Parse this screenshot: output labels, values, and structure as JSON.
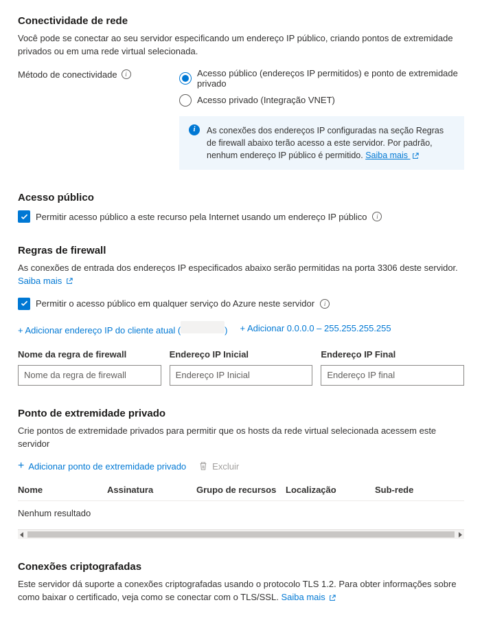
{
  "connectivity": {
    "heading": "Conectividade de rede",
    "desc": "Você pode se conectar ao seu servidor especificando um endereço IP público, criando pontos de extremidade privados ou em uma rede virtual selecionada.",
    "method_label": "Método de conectividade",
    "options": {
      "public": "Acesso público (endereços IP permitidos) e ponto de extremidade privado",
      "private": "Acesso privado (Integração VNET)"
    },
    "info": "As conexões dos endereços IP configuradas na seção Regras de firewall abaixo terão acesso a este servidor. Por padrão, nenhum endereço IP público é permitido.",
    "info_link": "Saiba mais"
  },
  "public_access": {
    "heading": "Acesso público",
    "checkbox": "Permitir acesso público a este recurso pela Internet usando um endereço IP público"
  },
  "firewall": {
    "heading": "Regras de firewall",
    "desc": "As conexões de entrada dos endereços IP especificados abaixo serão permitidas na porta 3306 deste servidor.",
    "learn_more": "Saiba mais",
    "azure_checkbox": "Permitir o acesso público em qualquer serviço do Azure neste servidor",
    "add_client_prefix": "+ Adicionar endereço IP do cliente atual (",
    "add_client_suffix": ")",
    "add_range": "+ Adicionar 0.0.0.0 – 255.255.255.255",
    "cols": {
      "name_label": "Nome da regra de firewall",
      "name_ph": "Nome da regra de firewall",
      "start_label": "Endereço IP Inicial",
      "start_ph": "Endereço IP Inicial",
      "end_label": "Endereço IP Final",
      "end_ph": "Endereço IP final"
    }
  },
  "private_endpoint": {
    "heading": "Ponto de extremidade privado",
    "desc": "Crie pontos de extremidade privados para permitir que os hosts da rede virtual selecionada acessem este servidor",
    "add_btn": "Adicionar ponto de extremidade privado",
    "delete_btn": "Excluir",
    "cols": {
      "name": "Nome",
      "subscription": "Assinatura",
      "rg": "Grupo de recursos",
      "location": "Localização",
      "subnet": "Sub-rede"
    },
    "empty": "Nenhum resultado"
  },
  "encrypted": {
    "heading": "Conexões criptografadas",
    "desc": "Este servidor dá suporte a conexões criptografadas usando o protocolo TLS 1.2. Para obter informações sobre como baixar o certificado, veja como se conectar com o TLS/SSL.",
    "learn_more": "Saiba mais"
  }
}
